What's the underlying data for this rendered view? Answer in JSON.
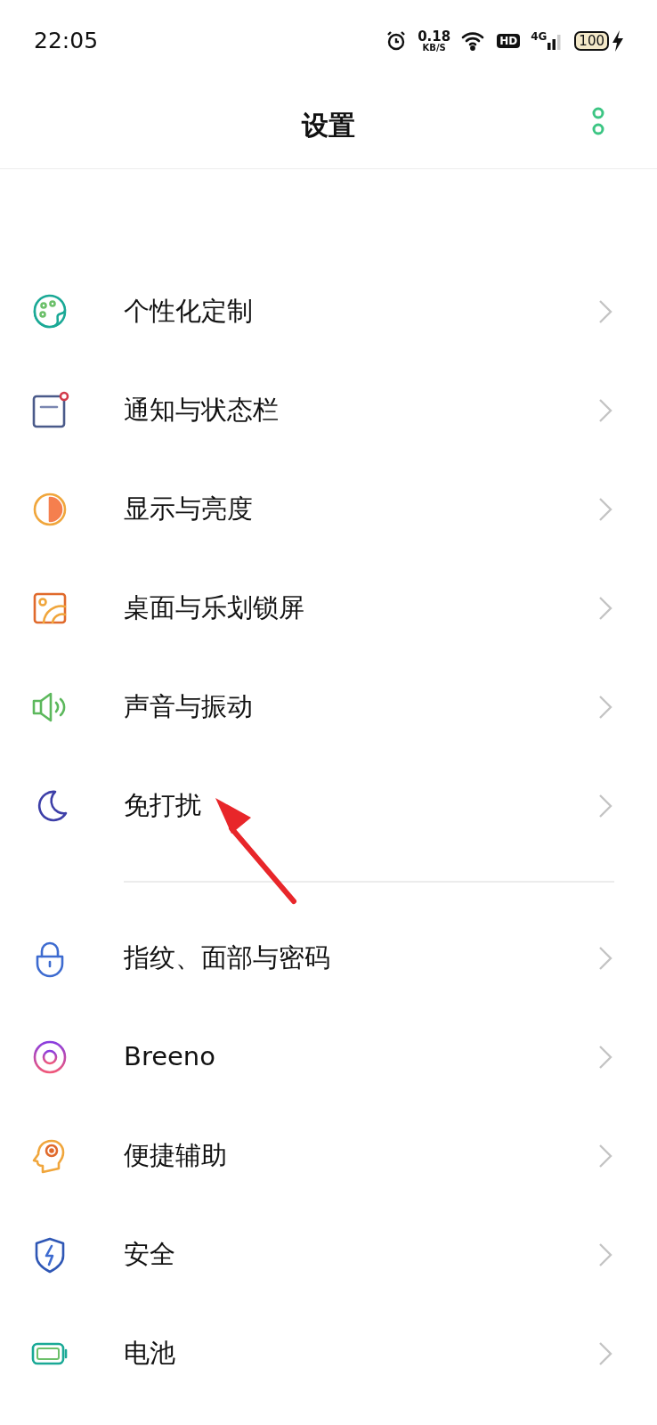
{
  "status_bar": {
    "time": "22:05",
    "net_speed": "0.18",
    "net_unit": "KB/S",
    "hd": "HD",
    "network": "4G",
    "battery": "100",
    "charging": true
  },
  "header": {
    "title": "设置"
  },
  "groups": [
    {
      "items": [
        {
          "label": "个性化定制"
        },
        {
          "label": "通知与状态栏"
        },
        {
          "label": "显示与亮度"
        },
        {
          "label": "桌面与乐划锁屏"
        },
        {
          "label": "声音与振动"
        },
        {
          "label": "免打扰"
        }
      ]
    },
    {
      "items": [
        {
          "label": "指纹、面部与密码"
        },
        {
          "label": "Breeno"
        },
        {
          "label": "便捷辅助"
        },
        {
          "label": "安全"
        },
        {
          "label": "电池"
        }
      ]
    }
  ],
  "annotation": {
    "kind": "arrow"
  }
}
